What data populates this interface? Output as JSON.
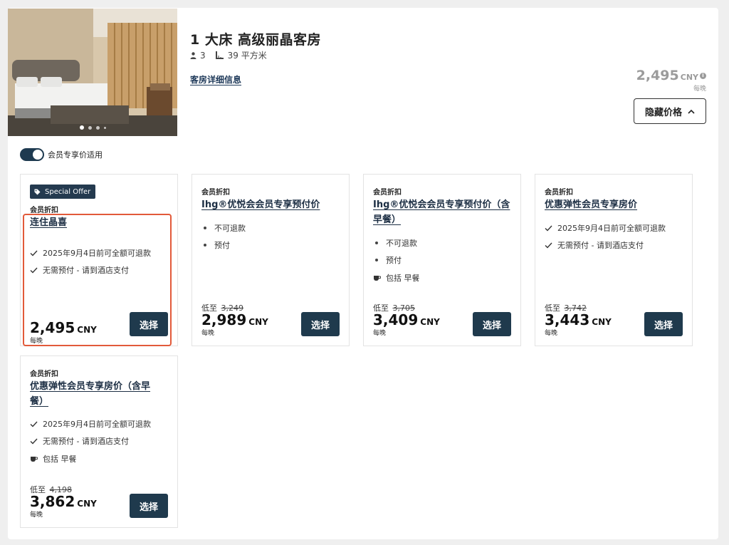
{
  "room": {
    "title": "1 大床 高级丽晶客房",
    "guests": "3",
    "area": "39 平方米",
    "details_link": "客房详细信息",
    "summary_price": "2,495",
    "summary_currency": "CNY",
    "summary_info_glyph": "i",
    "summary_per_night": "每晚",
    "hide_prices_label": "隐藏价格",
    "carousel": {
      "slide_count": 4,
      "active_index": 0
    }
  },
  "member_toggle": {
    "label": "会员专享价适用",
    "on": true
  },
  "rates": [
    {
      "badge": "Special Offer",
      "category": "会员折扣",
      "name": "连住晶喜",
      "features": [
        {
          "icon": "check-icon",
          "text": "2025年9月4日前可全额可退款"
        },
        {
          "icon": "check-icon",
          "text": "无需预付 - 请到酒店支付"
        }
      ],
      "from_label": "",
      "original_price": "",
      "price": "2,495",
      "currency": "CNY",
      "per_night": "每晚",
      "select_label": "选择",
      "highlighted": true
    },
    {
      "category": "会员折扣",
      "name": "Ihg®优悦会会员专享预付价",
      "features": [
        {
          "icon": "bullet-icon",
          "text": "不可退款"
        },
        {
          "icon": "bullet-icon",
          "text": "预付"
        }
      ],
      "from_label": "低至",
      "original_price": "3,249",
      "price": "2,989",
      "currency": "CNY",
      "per_night": "每晚",
      "select_label": "选择"
    },
    {
      "category": "会员折扣",
      "name_line1": "Ihg®优悦会会员专享预付价（含",
      "name_line2": "早餐）",
      "features": [
        {
          "icon": "bullet-icon",
          "text": "不可退款"
        },
        {
          "icon": "bullet-icon",
          "text": "预付"
        },
        {
          "icon": "coffee-cup-icon",
          "text": "包括 早餐"
        }
      ],
      "from_label": "低至",
      "original_price": "3,705",
      "price": "3,409",
      "currency": "CNY",
      "per_night": "每晚",
      "select_label": "选择"
    },
    {
      "category": "会员折扣",
      "name": "优惠弹性会员专享房价",
      "features": [
        {
          "icon": "check-icon",
          "text": "2025年9月4日前可全额可退款"
        },
        {
          "icon": "check-icon",
          "text": "无需预付 - 请到酒店支付"
        }
      ],
      "from_label": "低至",
      "original_price": "3,742",
      "price": "3,443",
      "currency": "CNY",
      "per_night": "每晚",
      "select_label": "选择"
    },
    {
      "category": "会员折扣",
      "name_line1": "优惠弹性会员专享房价（含早",
      "name_line2": "餐）",
      "features": [
        {
          "icon": "check-icon",
          "text": "2025年9月4日前可全额可退款"
        },
        {
          "icon": "check-icon",
          "text": "无需预付 - 请到酒店支付"
        },
        {
          "icon": "coffee-cup-icon",
          "text": "包括 早餐"
        }
      ],
      "from_label": "低至",
      "original_price": "4,198",
      "price": "3,862",
      "currency": "CNY",
      "per_night": "每晚",
      "select_label": "选择"
    }
  ],
  "colors": {
    "accent": "#1f3a4d",
    "link": "#1d2f44",
    "highlight": "#e25a3a",
    "muted_price": "#9b9b9b"
  }
}
